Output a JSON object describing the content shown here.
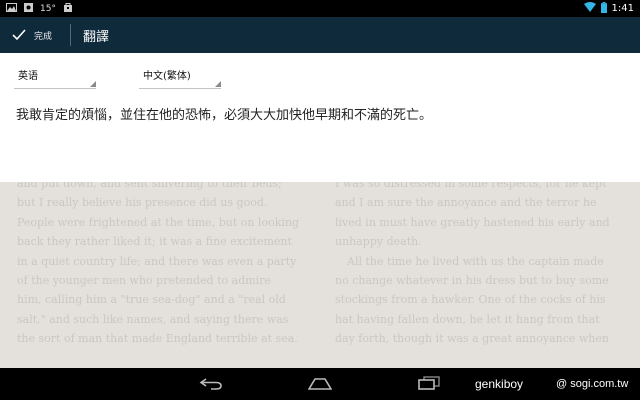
{
  "status_bar": {
    "temperature": "15°",
    "time": "1:41",
    "icons": [
      "picture-icon",
      "weather-icon",
      "bag-icon",
      "wifi-icon",
      "battery-icon"
    ]
  },
  "action_bar": {
    "done_label": "完成",
    "title": "翻譯",
    "icons": [
      "checkmark-icon"
    ]
  },
  "translate": {
    "source_language": "英语",
    "target_language": "中文(繁体)",
    "result": "我敢肯定的煩惱，並住在他的恐怖，必須大大加快他早期和不滿的死亡。"
  },
  "reader": {
    "left_column": [
      {
        "text": "and put down, and sent shivering to their beds;",
        "cont": true
      },
      {
        "text": "but I really believe his presence did us good.",
        "cont": true
      },
      {
        "text": "People were frightened at the time, but on looking",
        "cont": true
      },
      {
        "text": "back they rather liked it; it was a fine excitement",
        "cont": true
      },
      {
        "text": "in a quiet country life; and there was even a party",
        "cont": true
      },
      {
        "text": "of the younger men who pretended to admire",
        "cont": true
      },
      {
        "text": "him, calling him a \"true sea-dog\" and a \"real old",
        "cont": true
      },
      {
        "text": "salt,\" and such like names, and saying there was",
        "cont": true
      },
      {
        "text": "the sort of man that made England terrible at sea.",
        "cont": true
      }
    ],
    "right_column": [
      {
        "text": "I was so distressed in some respects, for he kept",
        "cont": true
      },
      {
        "text": "and I am sure the annoyance and the terror he",
        "cont": true
      },
      {
        "text": "lived in must have greatly hastened his early and",
        "cont": true
      },
      {
        "text": "unhappy death.",
        "cont": true
      },
      {
        "text": "All the time he lived with us the captain made",
        "cont": false
      },
      {
        "text": "no change whatever in his dress but to buy some",
        "cont": true
      },
      {
        "text": "stockings from a hawker. One of the cocks of his",
        "cont": true
      },
      {
        "text": "hat having fallen down, he let it hang from that",
        "cont": true
      },
      {
        "text": "day forth, though it was a great annoyance when",
        "cont": true
      }
    ]
  },
  "nav_bar": {
    "icons": [
      "back-icon",
      "home-icon",
      "recent-apps-icon"
    ]
  },
  "watermark": {
    "user": "genkiboy",
    "site": "@ sogi.com.tw"
  },
  "colors": {
    "action_bar_bg": "#0e2a3b",
    "reader_bg": "#e4e1dc",
    "panel_bg": "#ffffff"
  }
}
